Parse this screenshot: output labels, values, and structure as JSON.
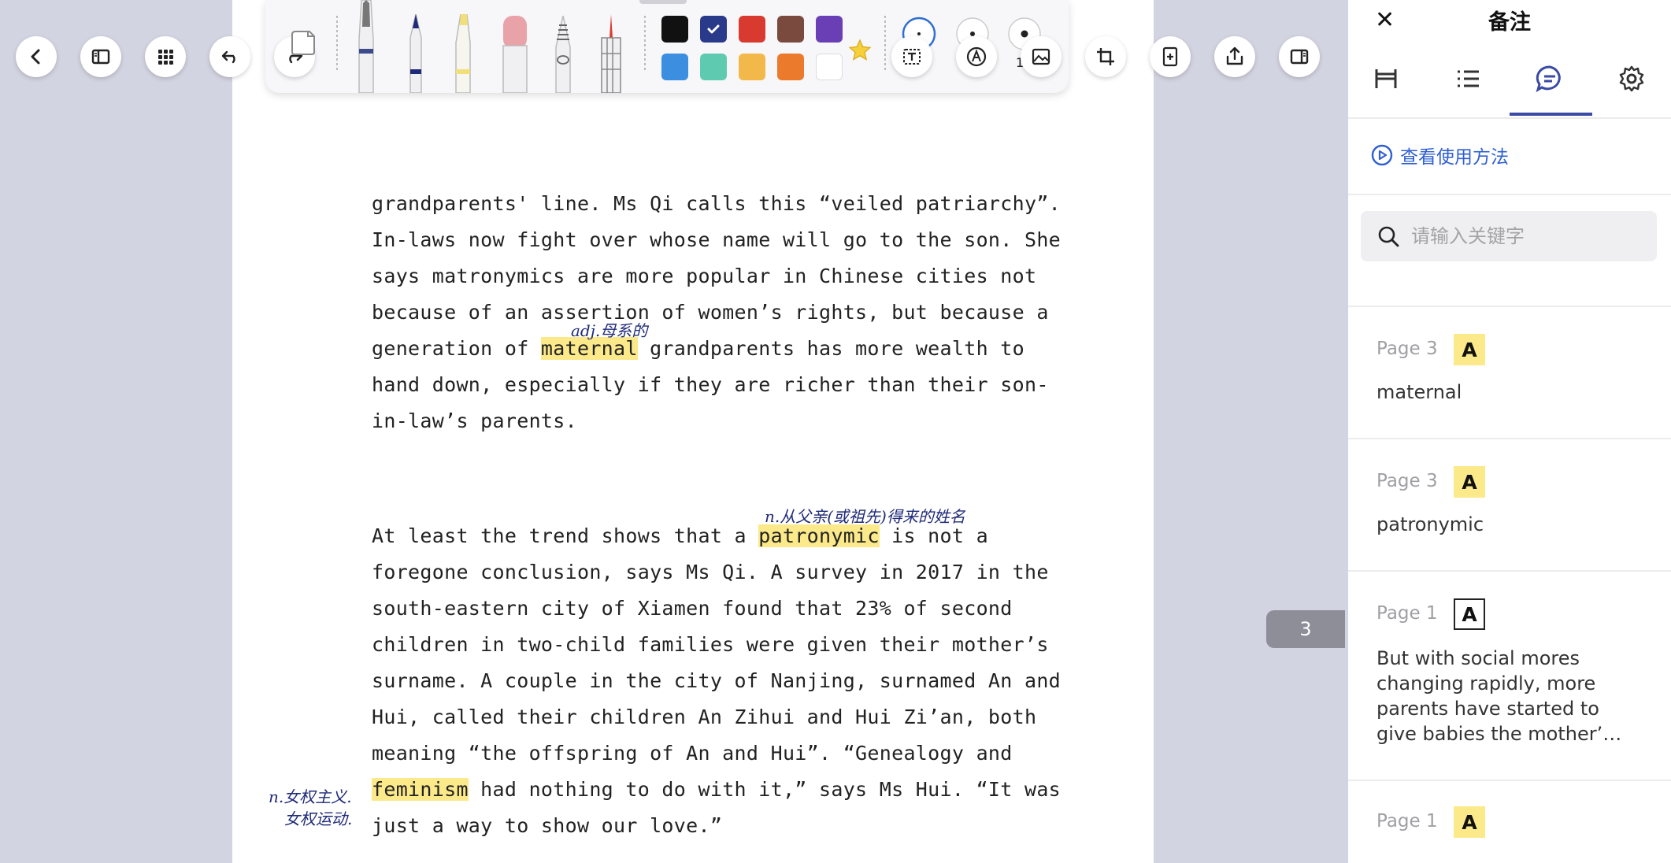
{
  "document": {
    "paragraph1": [
      "grandparents' line. Ms Qi calls this “veiled patriarchy”.",
      "In-laws now fight over whose name will go to the son. She",
      "says matronymics are more popular in Chinese cities not",
      "because of an assertion of women’s rights, but because a"
    ],
    "p1_l5_a": "generation of ",
    "p1_l5_hl": "maternal",
    "p1_l5_b": " grandparents has more wealth to",
    "p1_l6": "hand down, especially if they are richer than their son-",
    "p1_l7": "in-law’s parents.",
    "p2_l1_a": "At least the trend shows that a ",
    "p2_l1_hl": "patronymic",
    "p2_l1_b": " is not a",
    "paragraph2": [
      "foregone conclusion, says Ms Qi. A survey in 2017 in the",
      "south-eastern city of Xiamen found that 23% of second",
      "children in two-child families were given their mother’s",
      "surname. A couple in the city of Nanjing, surnamed An and",
      "Hui, called their children An Zihui and Hui Zi’an, both",
      "meaning “the offspring of An and Hui”. “Genealogy and"
    ],
    "p2_l8_hl": "feminism",
    "p2_l8_b": " had nothing to do with it,” says Ms Hui. “It was",
    "p2_l9": "just a way to show our love.”",
    "handwriting": {
      "maternal_note": "adj.母系的",
      "patronymic_note": "n.从父亲(或祖先)得来的姓名",
      "feminism_note_1": "n.女权主义.",
      "feminism_note_2": "女权运动."
    }
  },
  "toolbar": {
    "pen_size_label": "1",
    "swatches": [
      "#111111",
      "#2a3a8a",
      "#d93a30",
      "#7a4a3e",
      "#6a3fb5",
      "#3c8ee0",
      "#5ecbb0",
      "#f2b84a",
      "#ec7a2d",
      "#ffffff"
    ]
  },
  "page_indicator": "3",
  "panel": {
    "title": "备注",
    "how_to": "查看使用方法",
    "search_placeholder": "请输入关键字",
    "notes": [
      {
        "page": "Page 3",
        "icon": "A",
        "text": "maternal"
      },
      {
        "page": "Page 3",
        "icon": "A",
        "text": "patronymic"
      },
      {
        "page": "Page 1",
        "icon": "A",
        "text": "But with social mores changing rapidly, more parents have started to give babies the mother’…"
      },
      {
        "page": "Page 1",
        "icon": "A",
        "text": ""
      }
    ]
  },
  "colors": {
    "highlight": "#fbe98a",
    "accent": "#3a4aa5",
    "link": "#2f5fd0",
    "background": "#d3d4e1"
  }
}
